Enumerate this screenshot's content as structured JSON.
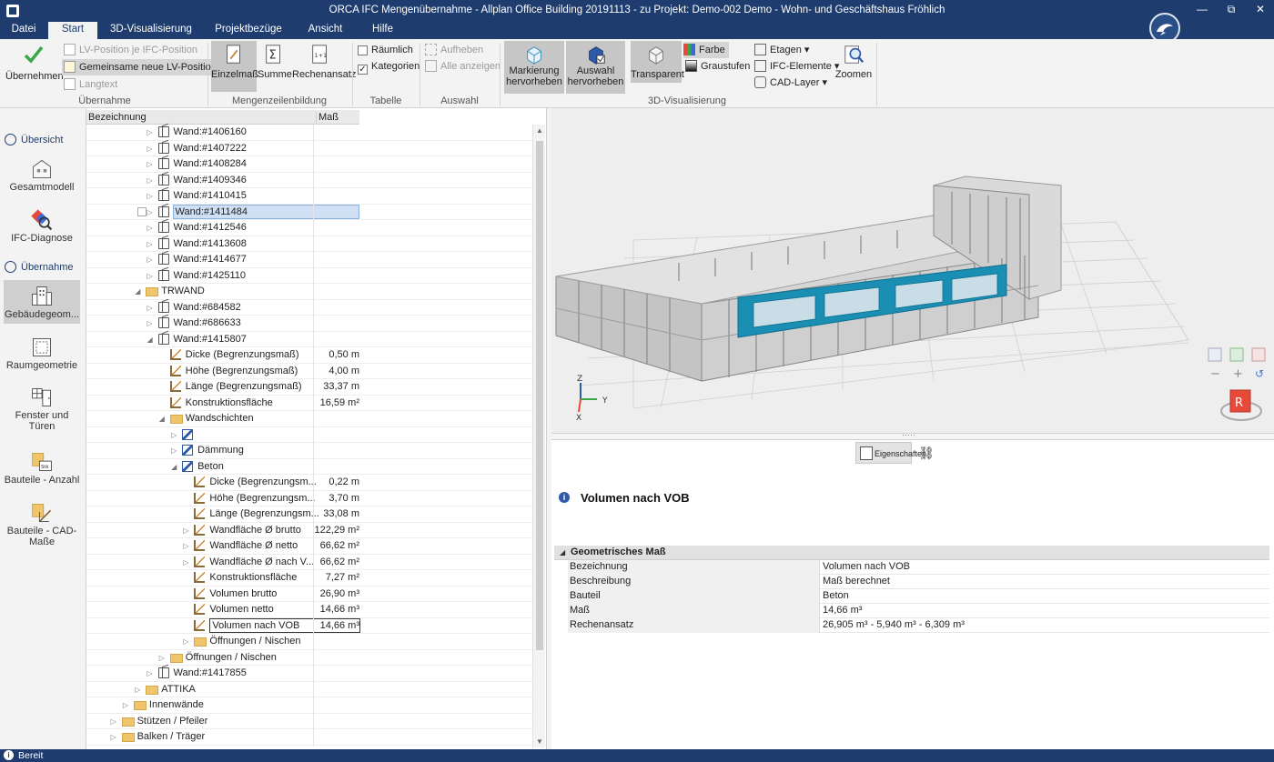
{
  "window": {
    "title": "ORCA IFC Mengenübernahme - Allplan Office Building 20191113 - zu Projekt: Demo-002 Demo - Wohn- und Geschäftshaus Fröhlich",
    "controls": {
      "minimize": "—",
      "restore": "⧉",
      "close": "✕"
    }
  },
  "menu_tabs": [
    "Datei",
    "Start",
    "3D-Visualisierung",
    "Projektbezüge",
    "Ansicht",
    "Hilfe"
  ],
  "ribbon": {
    "uebernahme": {
      "label": "Übernahme",
      "big": "Übernehmen",
      "lv_je_ifc": "LV-Position je IFC-Position",
      "gemeinsame": "Gemeinsame neue LV-Position",
      "langtext": "Langtext"
    },
    "mengen": {
      "label": "Mengenzeilenbildung",
      "einzelmass": "Einzelmaß",
      "summe": "Summe",
      "rechenansatz": "Rechenansatz"
    },
    "tabelle": {
      "label": "Tabelle",
      "raeumlich": "Räumlich",
      "kategorien": "Kategorien"
    },
    "auswahl": {
      "label": "Auswahl",
      "aufheben": "Aufheben",
      "alle_anzeigen": "Alle anzeigen"
    },
    "vis": {
      "label": "3D-Visualisierung",
      "markierung_1": "Markierung",
      "markierung_2": "hervorheben",
      "auswahl_1": "Auswahl",
      "auswahl_2": "hervorheben",
      "transparent": "Transparent",
      "farbe": "Farbe",
      "graustufen": "Graustufen",
      "etagen": "Etagen",
      "ifc_elemente": "IFC-Elemente",
      "cad_layer": "CAD-Layer",
      "zoomen": "Zoomen"
    }
  },
  "leftnav": {
    "section1": "Übersicht",
    "gesamtmodell": "Gesamtmodell",
    "ifc_diagnose": "IFC-Diagnose",
    "section2": "Übernahme",
    "gebaeudegeom": "Gebäudegeom...",
    "raumgeometrie": "Raumgeometrie",
    "fenster_1": "Fenster und",
    "fenster_2": "Türen",
    "bauteile_anzahl": "Bauteile - Anzahl",
    "bauteile_cad_1": "Bauteile - CAD-",
    "bauteile_cad_2": "Maße",
    "stk": "Stk"
  },
  "tree": {
    "col_name": "Bezeichnung",
    "col_value": "Maß",
    "rows": [
      {
        "indent": 5,
        "exp": "▷",
        "icon": "wall",
        "name": "Wand:#1406160",
        "value": ""
      },
      {
        "indent": 5,
        "exp": "▷",
        "icon": "wall",
        "name": "Wand:#1407222",
        "value": ""
      },
      {
        "indent": 5,
        "exp": "▷",
        "icon": "wall",
        "name": "Wand:#1408284",
        "value": ""
      },
      {
        "indent": 5,
        "exp": "▷",
        "icon": "wall",
        "name": "Wand:#1409346",
        "value": ""
      },
      {
        "indent": 5,
        "exp": "▷",
        "icon": "wall",
        "name": "Wand:#1410415",
        "value": ""
      },
      {
        "indent": 5,
        "exp": "▷",
        "icon": "wall",
        "name": "Wand:#1411484",
        "value": "",
        "selected": true
      },
      {
        "indent": 5,
        "exp": "▷",
        "icon": "wall",
        "name": "Wand:#1412546",
        "value": ""
      },
      {
        "indent": 5,
        "exp": "▷",
        "icon": "wall",
        "name": "Wand:#1413608",
        "value": ""
      },
      {
        "indent": 5,
        "exp": "▷",
        "icon": "wall",
        "name": "Wand:#1414677",
        "value": ""
      },
      {
        "indent": 5,
        "exp": "▷",
        "icon": "wall",
        "name": "Wand:#1425110",
        "value": ""
      },
      {
        "indent": 4,
        "exp": "◢",
        "icon": "folder",
        "name": "TRWAND",
        "value": ""
      },
      {
        "indent": 5,
        "exp": "▷",
        "icon": "wall",
        "name": "Wand:#684582",
        "value": ""
      },
      {
        "indent": 5,
        "exp": "▷",
        "icon": "wall",
        "name": "Wand:#686633",
        "value": ""
      },
      {
        "indent": 5,
        "exp": "◢",
        "icon": "wall",
        "name": "Wand:#1415807",
        "value": ""
      },
      {
        "indent": 6,
        "exp": "",
        "icon": "meas",
        "name": "Dicke (Begrenzungsmaß)",
        "value": "0,50 m"
      },
      {
        "indent": 6,
        "exp": "",
        "icon": "meas",
        "name": "Höhe (Begrenzungsmaß)",
        "value": "4,00 m"
      },
      {
        "indent": 6,
        "exp": "",
        "icon": "meas",
        "name": "Länge (Begrenzungsmaß)",
        "value": "33,37 m"
      },
      {
        "indent": 6,
        "exp": "",
        "icon": "meas",
        "name": "Konstruktionsfläche",
        "value": "16,59 m²"
      },
      {
        "indent": 6,
        "exp": "◢",
        "icon": "folder",
        "name": "Wandschichten",
        "value": ""
      },
      {
        "indent": 7,
        "exp": "▷",
        "icon": "layer",
        "name": "",
        "value": ""
      },
      {
        "indent": 7,
        "exp": "▷",
        "icon": "layer",
        "name": "Dämmung",
        "value": ""
      },
      {
        "indent": 7,
        "exp": "◢",
        "icon": "layer",
        "name": "Beton",
        "value": ""
      },
      {
        "indent": 8,
        "exp": "",
        "icon": "meas",
        "name": "Dicke (Begrenzungsm...",
        "value": "0,22 m"
      },
      {
        "indent": 8,
        "exp": "",
        "icon": "meas",
        "name": "Höhe (Begrenzungsm...",
        "value": "3,70 m"
      },
      {
        "indent": 8,
        "exp": "",
        "icon": "meas",
        "name": "Länge (Begrenzungsm...",
        "value": "33,08 m"
      },
      {
        "indent": 8,
        "exp": "▷",
        "icon": "meas",
        "name": "Wandfläche Ø brutto",
        "value": "122,29 m²"
      },
      {
        "indent": 8,
        "exp": "▷",
        "icon": "meas",
        "name": "Wandfläche Ø netto",
        "value": "66,62 m²"
      },
      {
        "indent": 8,
        "exp": "▷",
        "icon": "meas",
        "name": "Wandfläche Ø nach V...",
        "value": "66,62 m²"
      },
      {
        "indent": 8,
        "exp": "",
        "icon": "meas",
        "name": "Konstruktionsfläche",
        "value": "7,27 m²"
      },
      {
        "indent": 8,
        "exp": "",
        "icon": "meas",
        "name": "Volumen brutto",
        "value": "26,90 m³"
      },
      {
        "indent": 8,
        "exp": "",
        "icon": "meas",
        "name": "Volumen netto",
        "value": "14,66 m³"
      },
      {
        "indent": 8,
        "exp": "",
        "icon": "meas",
        "name": "Volumen nach VOB",
        "value": "14,66 m³",
        "focused": true
      },
      {
        "indent": 8,
        "exp": "▷",
        "icon": "folder",
        "name": "Öffnungen / Nischen",
        "value": ""
      },
      {
        "indent": 6,
        "exp": "▷",
        "icon": "folder",
        "name": "Öffnungen / Nischen",
        "value": ""
      },
      {
        "indent": 5,
        "exp": "▷",
        "icon": "wall",
        "name": "Wand:#1417855",
        "value": ""
      },
      {
        "indent": 4,
        "exp": "▷",
        "icon": "folder",
        "name": "ATTIKA",
        "value": ""
      },
      {
        "indent": 3,
        "exp": "▷",
        "icon": "folder",
        "name": "Innenwände",
        "value": ""
      },
      {
        "indent": 2,
        "exp": "▷",
        "icon": "folder",
        "name": "Stützen / Pfeiler",
        "value": ""
      },
      {
        "indent": 2,
        "exp": "▷",
        "icon": "folder",
        "name": "Balken / Träger",
        "value": ""
      }
    ]
  },
  "viewport": {
    "axis_z": "Z",
    "axis_y": "Y",
    "axis_x": "X",
    "cube_label": "R",
    "zoom_out": "−",
    "zoom_in": "+",
    "reset": "↺",
    "highlight_color": "#1b8fb3"
  },
  "properties": {
    "tab_eigenschaften": "Eigenschaften",
    "title": "Volumen nach VOB",
    "group": "Geometrisches Maß",
    "rows": [
      {
        "key": "Bezeichnung",
        "value": "Volumen nach VOB"
      },
      {
        "key": "Beschreibung",
        "value": "Maß berechnet"
      },
      {
        "key": "Bauteil",
        "value": "Beton"
      },
      {
        "key": "Maß",
        "value": "14,66 m³"
      },
      {
        "key": "Rechenansatz",
        "value": "26,905 m³ - 5,940 m³ - 6,309 m³"
      }
    ]
  },
  "status": {
    "text": "Bereit"
  },
  "colors": {
    "brand": "#1e3c6e",
    "selection": "#cfe0f5",
    "accent_green": "#3aa84a"
  }
}
